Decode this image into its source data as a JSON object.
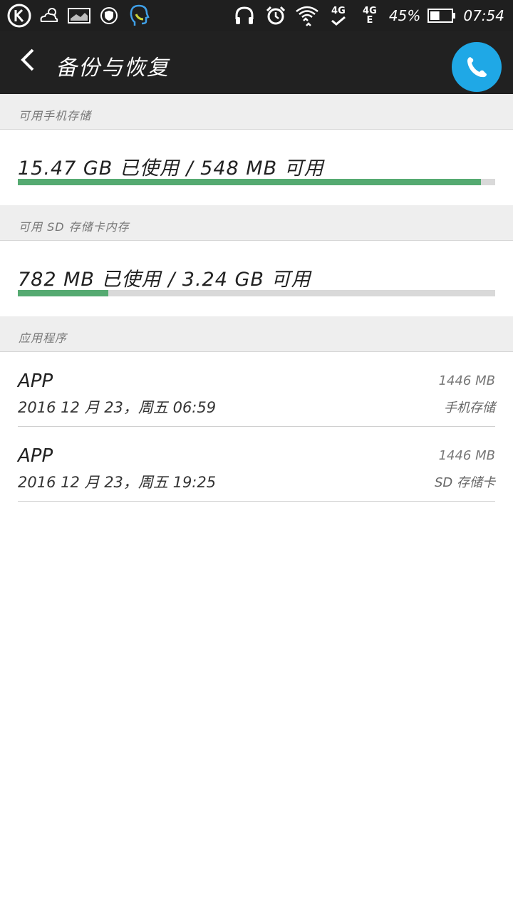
{
  "status_bar": {
    "left_icons": [
      "k-app-icon",
      "weather-cloudy-sun-icon",
      "image-notification-icon",
      "shield-icon",
      "headset-assistant-icon"
    ],
    "right_icons": [
      "headphones-icon",
      "alarm-clock-icon",
      "wifi-icon",
      "4g-icon",
      "signal-icon",
      "battery-icon"
    ],
    "network_top": "4G",
    "network_sim_top": "4G",
    "network_sim_bottom": "E",
    "battery": "45%",
    "battery_level": 0.45,
    "time": "07:54"
  },
  "app_bar": {
    "title": "备份与恢复",
    "back_icon": "chevron-left-icon",
    "fab_icon": "phone-icon",
    "fab_color": "#1fa8e6"
  },
  "sections": {
    "phone_storage": {
      "header": "可用手机存储",
      "usage_text": "15.47 GB 已使用 / 548 MB 可用",
      "used_fraction": 0.97
    },
    "sd_storage": {
      "header": "可用 SD 存储卡内存",
      "usage_text": "782 MB 已使用 / 3.24 GB 可用",
      "used_fraction": 0.19
    },
    "apps": {
      "header": "应用程序",
      "items": [
        {
          "name": "APP",
          "date": "2016 12 月 23，周五 06:59",
          "size": "1446 MB",
          "location": "手机存储"
        },
        {
          "name": "APP",
          "date": "2016 12 月 23，周五 19:25",
          "size": "1446 MB",
          "location": "SD 存储卡"
        }
      ]
    }
  },
  "colors": {
    "bar_fill": "#55aa71",
    "bar_track": "#d9d9d9",
    "app_bar_bg": "#212121",
    "status_bar_bg": "#1f1f1f"
  }
}
